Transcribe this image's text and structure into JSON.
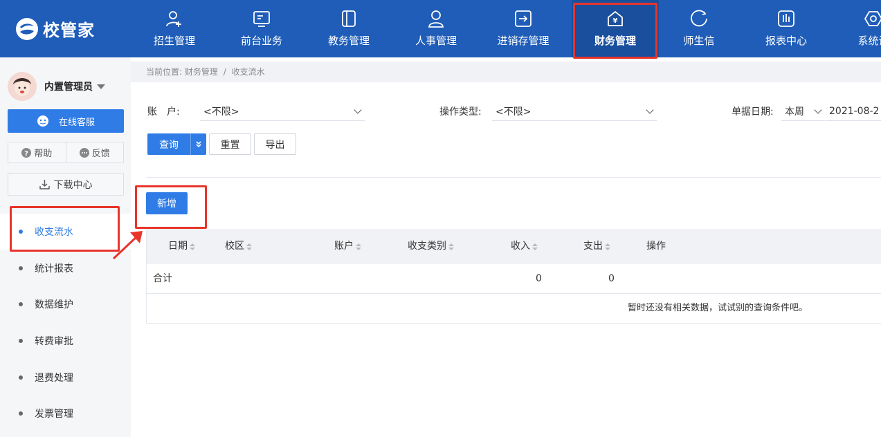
{
  "app": {
    "logo_text": "校管家",
    "brand_color": "#1f5db8",
    "accent_color": "#2f7ce6",
    "annotation_color": "#e8342a"
  },
  "topnav": {
    "items": [
      {
        "label": "招生管理",
        "icon": "user-plus-icon"
      },
      {
        "label": "前台业务",
        "icon": "monitor-icon"
      },
      {
        "label": "教务管理",
        "icon": "book-icon"
      },
      {
        "label": "人事管理",
        "icon": "person-icon"
      },
      {
        "label": "进销存管理",
        "icon": "inventory-icon"
      },
      {
        "label": "财务管理",
        "icon": "yen-house-icon",
        "active": true
      },
      {
        "label": "师生信",
        "icon": "chat-icon"
      },
      {
        "label": "报表中心",
        "icon": "bar-chart-icon"
      },
      {
        "label": "系统设",
        "icon": "settings-icon"
      }
    ]
  },
  "sidebar": {
    "user_name": "内置管理员",
    "service_label": "在线客服",
    "help_label": "帮助",
    "feedback_label": "反馈",
    "download_label": "下载中心",
    "menu": [
      {
        "label": "收支流水",
        "active": true
      },
      {
        "label": "统计报表"
      },
      {
        "label": "数据维护"
      },
      {
        "label": "转费审批"
      },
      {
        "label": "退费处理"
      },
      {
        "label": "发票管理"
      }
    ]
  },
  "breadcrumb": {
    "prefix": "当前位置:",
    "path1": "财务管理",
    "sep": "/",
    "path2": "收支流水"
  },
  "filters": {
    "account_label": "账　户:",
    "account_value": "<不限>",
    "optype_label": "操作类型:",
    "optype_value": "<不限>",
    "date_label": "单据日期:",
    "date_range_value": "本周",
    "date_start_value": "2021-08-2"
  },
  "actions": {
    "query_label": "查询",
    "reset_label": "重置",
    "export_label": "导出",
    "add_label": "新增"
  },
  "table": {
    "columns": [
      "日期",
      "校区",
      "账户",
      "收支类别",
      "收入",
      "支出",
      "操作"
    ],
    "total_row": {
      "label": "合计",
      "income": "0",
      "expense": "0"
    },
    "empty_text": "暂时还没有相关数据，试试别的查询条件吧。"
  }
}
